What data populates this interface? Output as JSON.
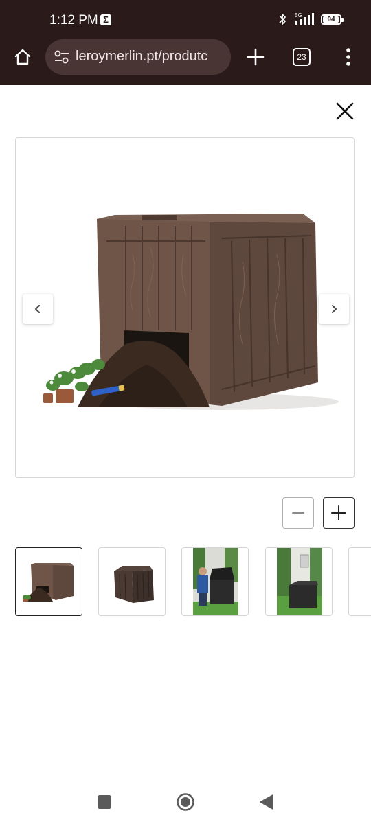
{
  "status_bar": {
    "time": "1:12 PM",
    "network": "5G",
    "battery": "94"
  },
  "browser": {
    "url": "leroymerlin.pt/produtc",
    "tab_count": "23",
    "icons": [
      "home-icon",
      "site-settings-icon",
      "plus-icon",
      "tab-switcher-icon",
      "more-vert-icon"
    ]
  },
  "viewer": {
    "close_icon": "close-icon",
    "prev_icon": "chevron-left-icon",
    "next_icon": "chevron-right-icon",
    "zoom_out_icon": "minus-icon",
    "zoom_in_icon": "plus-icon",
    "main_image": "brown wood-effect compost bin with soil spilling from bottom hatch, potted plant and garden trowel",
    "thumbnails": [
      {
        "subject": "compost bin with soil",
        "selected": true
      },
      {
        "subject": "compost bin studio shot",
        "selected": false
      },
      {
        "subject": "person using compost bin in garden",
        "selected": false
      },
      {
        "subject": "compost bin on lawn",
        "selected": false
      },
      {
        "subject": "partially visible thumbnail",
        "selected": false
      }
    ]
  },
  "android_nav": {
    "icons": [
      "recents-square-icon",
      "home-circle-icon",
      "back-triangle-icon"
    ]
  },
  "colors": {
    "chrome_bg": "#2a1a1a",
    "urlbar_bg": "#4a3535",
    "bin_brown": "#6b5246",
    "soil": "#3b2a1f"
  }
}
